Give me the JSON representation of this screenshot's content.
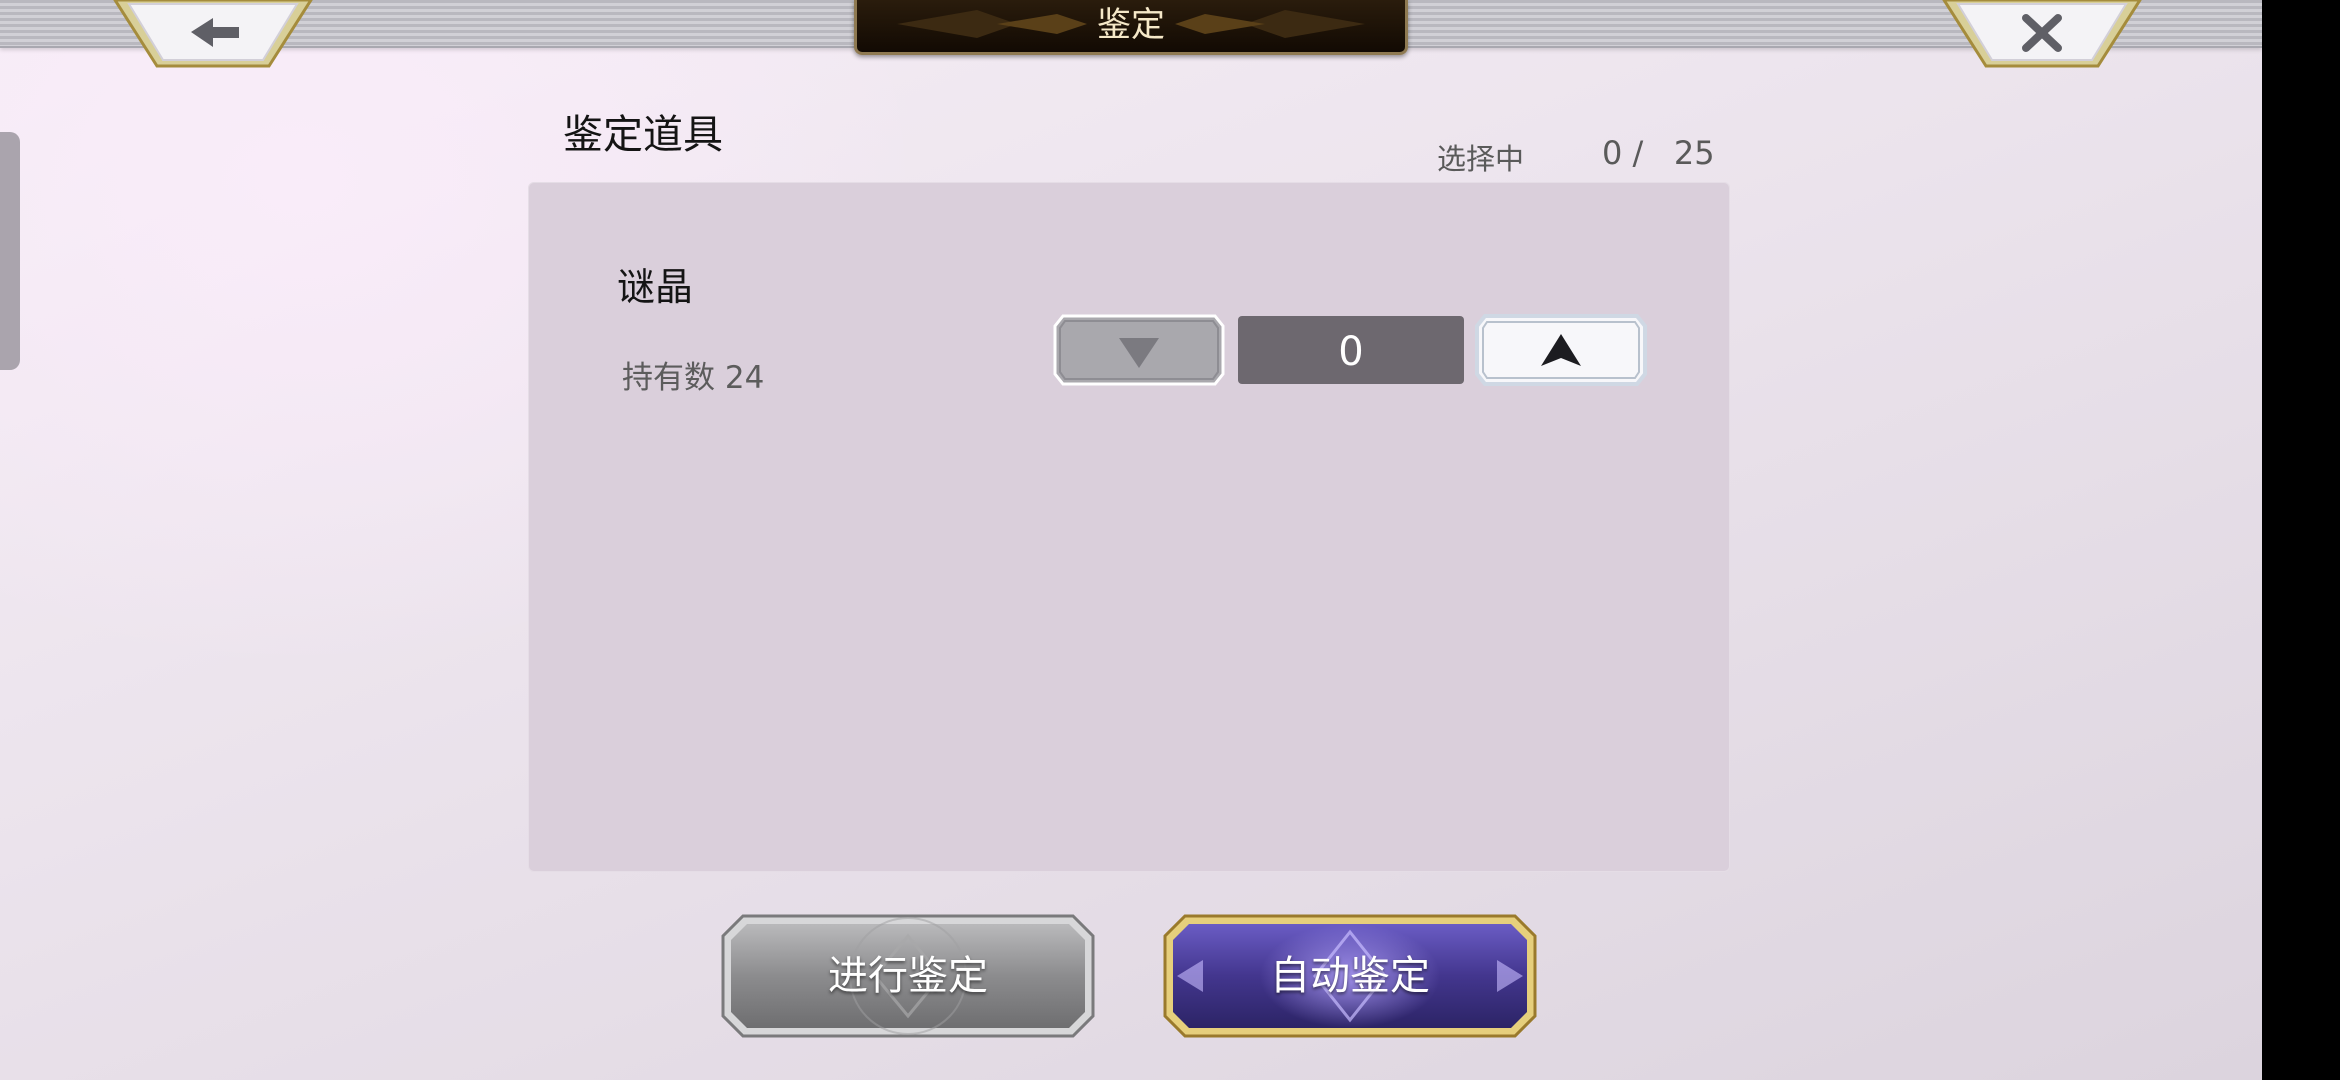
{
  "header": {
    "title": "鉴定",
    "back_icon": "arrow-left-icon",
    "close_icon": "close-x-icon"
  },
  "section": {
    "title": "鉴定道具",
    "selection_label": "选择中",
    "selected": "0",
    "separator": "/",
    "max": "25"
  },
  "item": {
    "name": "谜晶",
    "owned_label": "持有数 24",
    "quantity": "0",
    "decrease_icon": "triangle-down-icon",
    "increase_icon": "triangle-up-icon"
  },
  "actions": {
    "appraise_label": "进行鉴定",
    "auto_appraise_label": "自动鉴定"
  },
  "colors": {
    "panel": "#dacfdb",
    "gold_frame": "#c9a94f",
    "purple_button": "#4b3e9a",
    "gray_button": "#8a8a8c",
    "quantity_box": "#6d686f"
  }
}
